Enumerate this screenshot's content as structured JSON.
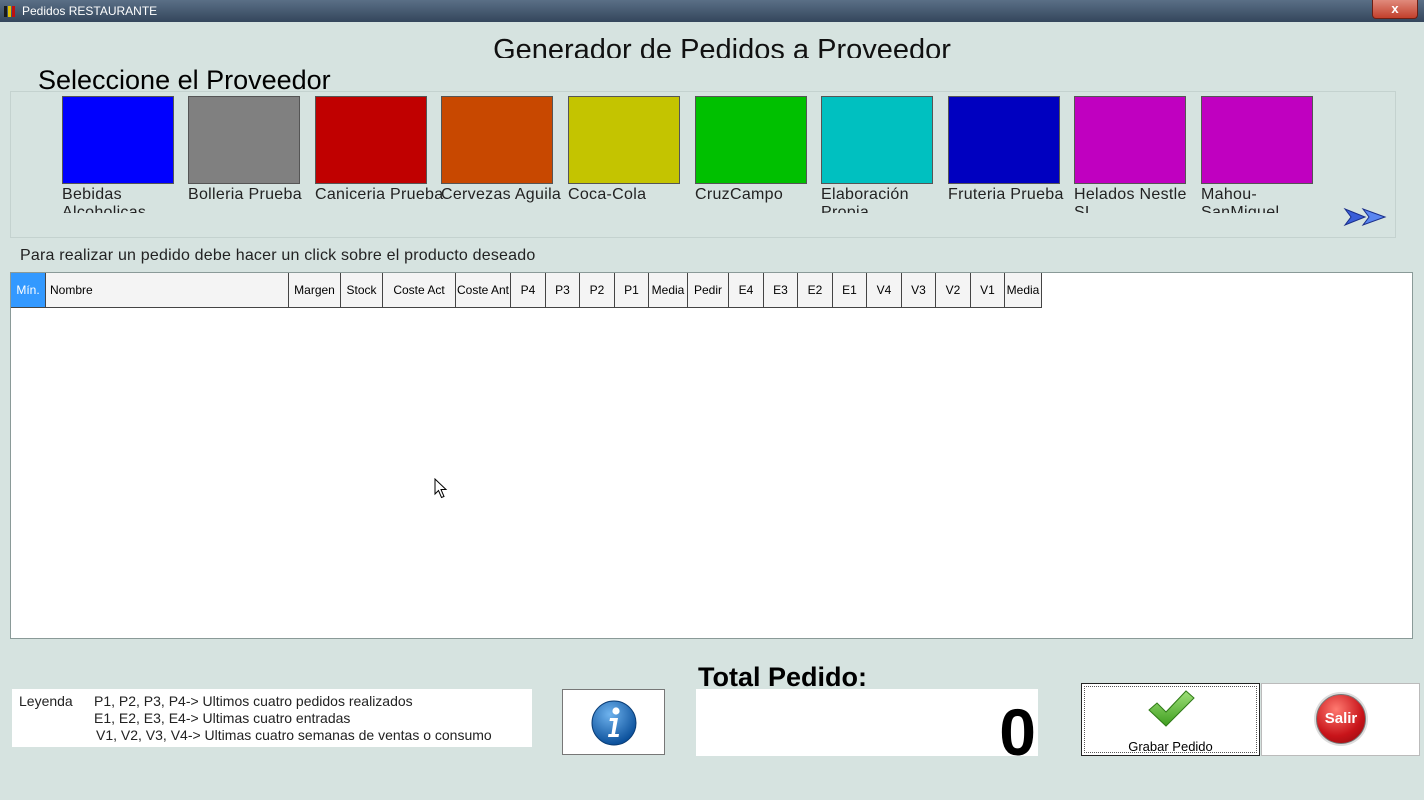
{
  "window": {
    "title": "Pedidos RESTAURANTE",
    "close_label": "x"
  },
  "main_title": "Generador de Pedidos a Proveedor",
  "select_title": "Seleccione el Proveedor",
  "suppliers": [
    {
      "name": "Bebidas Alcoholicas",
      "color": "#0000ff"
    },
    {
      "name": "Bolleria Prueba",
      "color": "#808080"
    },
    {
      "name": "Caniceria Prueba",
      "color": "#c00000"
    },
    {
      "name": "Cervezas Aguila",
      "color": "#c84800"
    },
    {
      "name": "Coca-Cola",
      "color": "#c4c400"
    },
    {
      "name": "CruzCampo",
      "color": "#00c000"
    },
    {
      "name": "Elaboración Propia",
      "color": "#00c0c0"
    },
    {
      "name": "Fruteria Prueba",
      "color": "#0000c0"
    },
    {
      "name": "Helados Nestle SL",
      "color": "#c000c0"
    },
    {
      "name": "Mahou-SanMiguel",
      "color": "#c000c0"
    }
  ],
  "instruction": "Para realizar un pedido debe hacer un click sobre el producto deseado",
  "grid": {
    "columns": [
      "Mín.",
      "Nombre",
      "Margen",
      "Stock",
      "Coste Act",
      "Coste Ant",
      "P4",
      "P3",
      "P2",
      "P1",
      "Media",
      "Pedir",
      "E4",
      "E3",
      "E2",
      "E1",
      "V4",
      "V3",
      "V2",
      "V1",
      "Media"
    ],
    "rows": []
  },
  "legend": {
    "label": "Leyenda",
    "line1": "P1, P2, P3, P4-> Ultimos cuatro pedidos realizados",
    "line2": "E1, E2, E3, E4-> Ultimas cuatro entradas",
    "line3": "V1, V2, V3, V4-> Ultimas cuatro semanas de ventas o consumo"
  },
  "total": {
    "label": "Total Pedido:",
    "value": "0"
  },
  "buttons": {
    "save_label": "Grabar Pedido",
    "exit_label": "Salir"
  }
}
